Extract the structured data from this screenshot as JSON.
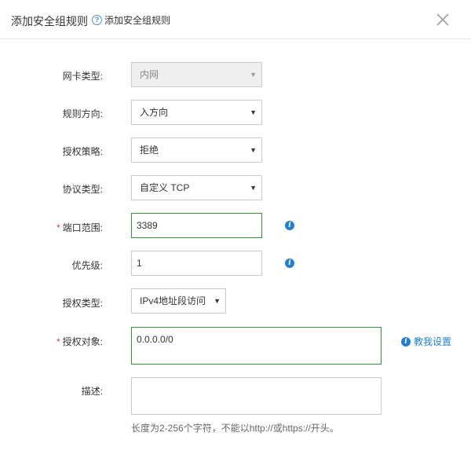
{
  "dialog": {
    "title": "添加安全组规则",
    "help_text": "添加安全组规则",
    "help_icon": "?",
    "close_icon": "close-icon"
  },
  "form": {
    "nic_type": {
      "label": "网卡类型:",
      "value": "内网",
      "disabled": true
    },
    "direction": {
      "label": "规则方向:",
      "value": "入方向"
    },
    "policy": {
      "label": "授权策略:",
      "value": "拒绝"
    },
    "protocol": {
      "label": "协议类型:",
      "value": "自定义 TCP"
    },
    "port_range": {
      "required_mark": "*",
      "label": "端口范围:",
      "value": "3389"
    },
    "priority": {
      "label": "优先级:",
      "value": "1"
    },
    "auth_type": {
      "label": "授权类型:",
      "value": "IPv4地址段访问"
    },
    "auth_object": {
      "required_mark": "*",
      "label": "授权对象:",
      "value": "0.0.0.0/0",
      "link_text": "教我设置"
    },
    "description": {
      "label": "描述:",
      "value": "",
      "hint": "长度为2-256个字符，不能以http://或https://开头。"
    }
  },
  "colors": {
    "accent": "#1f7fd6",
    "valid_border": "#2e9b2e",
    "required": "#e4393c"
  }
}
